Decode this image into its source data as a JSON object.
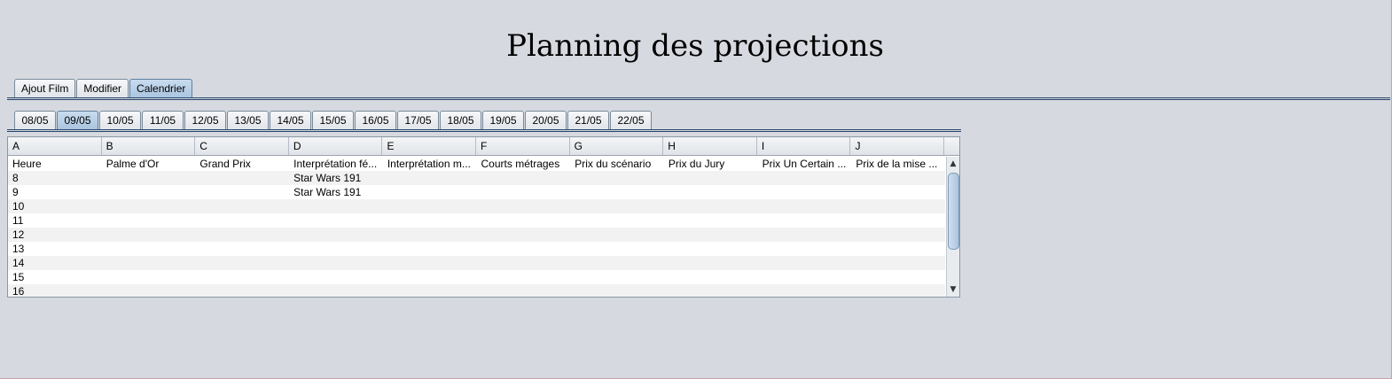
{
  "page_title": "Planning des projections",
  "main_tabs": [
    "Ajout Film",
    "Modifier",
    "Calendrier"
  ],
  "main_tab_selected": 2,
  "date_tabs": [
    "08/05",
    "09/05",
    "10/05",
    "11/05",
    "12/05",
    "13/05",
    "14/05",
    "15/05",
    "16/05",
    "17/05",
    "18/05",
    "19/05",
    "20/05",
    "21/05",
    "22/05"
  ],
  "date_tab_selected": 1,
  "table": {
    "columns": [
      "A",
      "B",
      "C",
      "D",
      "E",
      "F",
      "G",
      "H",
      "I",
      "J"
    ],
    "rows": [
      [
        "Heure",
        "Palme d'Or",
        "Grand Prix",
        "Interprétation fé...",
        "Interprétation m...",
        "Courts métrages",
        "Prix du scénario",
        "Prix du Jury",
        "Prix Un Certain ...",
        "Prix de la mise ..."
      ],
      [
        "8",
        "",
        "",
        "Star Wars 191",
        "",
        "",
        "",
        "",
        "",
        ""
      ],
      [
        "9",
        "",
        "",
        "Star Wars 191",
        "",
        "",
        "",
        "",
        "",
        ""
      ],
      [
        "10",
        "",
        "",
        "",
        "",
        "",
        "",
        "",
        "",
        ""
      ],
      [
        "11",
        "",
        "",
        "",
        "",
        "",
        "",
        "",
        "",
        ""
      ],
      [
        "12",
        "",
        "",
        "",
        "",
        "",
        "",
        "",
        "",
        ""
      ],
      [
        "13",
        "",
        "",
        "",
        "",
        "",
        "",
        "",
        "",
        ""
      ],
      [
        "14",
        "",
        "",
        "",
        "",
        "",
        "",
        "",
        "",
        ""
      ],
      [
        "15",
        "",
        "",
        "",
        "",
        "",
        "",
        "",
        "",
        ""
      ],
      [
        "16",
        "",
        "",
        "",
        "",
        "",
        "",
        "",
        "",
        ""
      ]
    ]
  },
  "scrollbar": {
    "up_arrow": "▲",
    "down_arrow": "▼"
  },
  "colors": {
    "background": "#d6d9df",
    "selected_tab": "#a9c4df",
    "separator": "#27456a"
  }
}
